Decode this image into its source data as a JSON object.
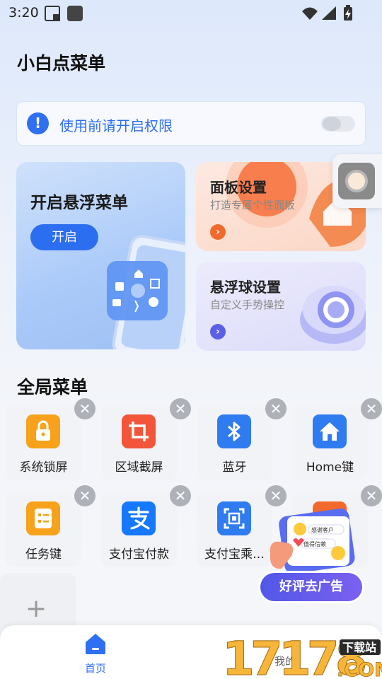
{
  "status_bar": {
    "time": "3:20"
  },
  "header": {
    "title": "小白点菜单"
  },
  "permission": {
    "text": "使用前请开启权限",
    "enabled": false
  },
  "cards": {
    "floating_menu": {
      "title": "开启悬浮菜单",
      "button": "开启"
    },
    "panel_settings": {
      "title": "面板设置",
      "subtitle": "打造专属个性面板"
    },
    "ball_settings": {
      "title": "悬浮球设置",
      "subtitle": "自定义手势操控"
    }
  },
  "global_menu": {
    "title": "全局菜单",
    "items": [
      {
        "label": "系统锁屏",
        "icon": "lock-icon",
        "color": "#f7a21a"
      },
      {
        "label": "区域截屏",
        "icon": "crop-icon",
        "color": "#f2553a"
      },
      {
        "label": "蓝牙",
        "icon": "bluetooth-icon",
        "color": "#2f7bf0"
      },
      {
        "label": "Home键",
        "icon": "home-icon",
        "color": "#2f7bf0"
      },
      {
        "label": "任务键",
        "icon": "task-list-icon",
        "color": "#f7a21a"
      },
      {
        "label": "支付宝付款",
        "icon": "alipay-icon",
        "color": "#1677ff"
      },
      {
        "label": "支付宝乘…",
        "icon": "qr-scan-icon",
        "color": "#2f7bf0"
      },
      {
        "label": "",
        "icon": "app-icon",
        "color": "#f26a2b"
      }
    ]
  },
  "ad": {
    "label": "好评去广告",
    "bubble_lines": [
      "感谢客户",
      "值得信赖"
    ]
  },
  "bottom_nav": {
    "home": "首页",
    "mine": "我的"
  },
  "watermark": {
    "brand": "17178",
    "suffix": ".COM",
    "tag": "下载站"
  }
}
